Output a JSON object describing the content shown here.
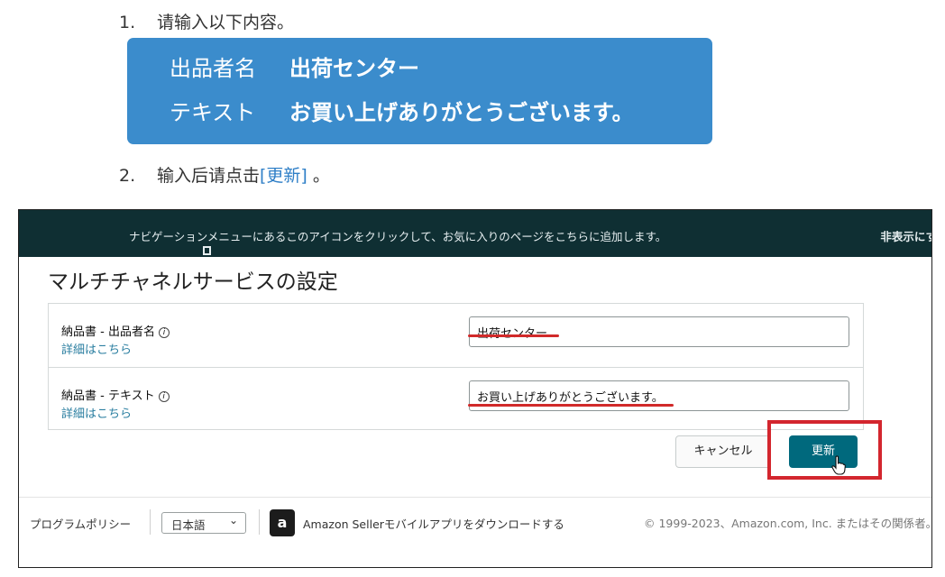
{
  "instructions": {
    "step1": {
      "number": "1.",
      "text": "请输入以下内容。"
    },
    "values_box": {
      "rows": [
        {
          "key": "出品者名",
          "value": "出荷センター"
        },
        {
          "key": "テキスト",
          "value": "お買い上げありがとうございます。"
        }
      ]
    },
    "step2": {
      "number": "2.",
      "text_before": "输入后请点击",
      "link": "[更新]",
      "text_after": " 。"
    }
  },
  "screen": {
    "navbar": {
      "message": "ナビゲーションメニューにあるこのアイコンをクリックして、お気に入りのページをこちらに追加します。",
      "hide_label": "非表示にす"
    },
    "title": "マルチチャネルサービスの設定",
    "fields": [
      {
        "label": "納品書 - 出品者名",
        "info": "i",
        "more": "詳細はこちら",
        "value": "出荷センター"
      },
      {
        "label": "納品書 - テキスト",
        "info": "i",
        "more": "詳細はこちら",
        "value": "お買い上げありがとうございます。"
      }
    ],
    "buttons": {
      "cancel": "キャンセル",
      "update": "更新"
    },
    "footer": {
      "policy": "プログラムポリシー",
      "language": "日本語",
      "app_icon_letter": "a",
      "app_text": "Amazon Sellerモバイルアプリをダウンロードする",
      "copyright": "© 1999-2023、Amazon.com, Inc. またはその関係者。"
    }
  },
  "colors": {
    "highlight_box": "#3b8ccc",
    "navbar": "#0f2f33",
    "primary_button": "#00697d",
    "annotation_red": "#d3262e"
  }
}
